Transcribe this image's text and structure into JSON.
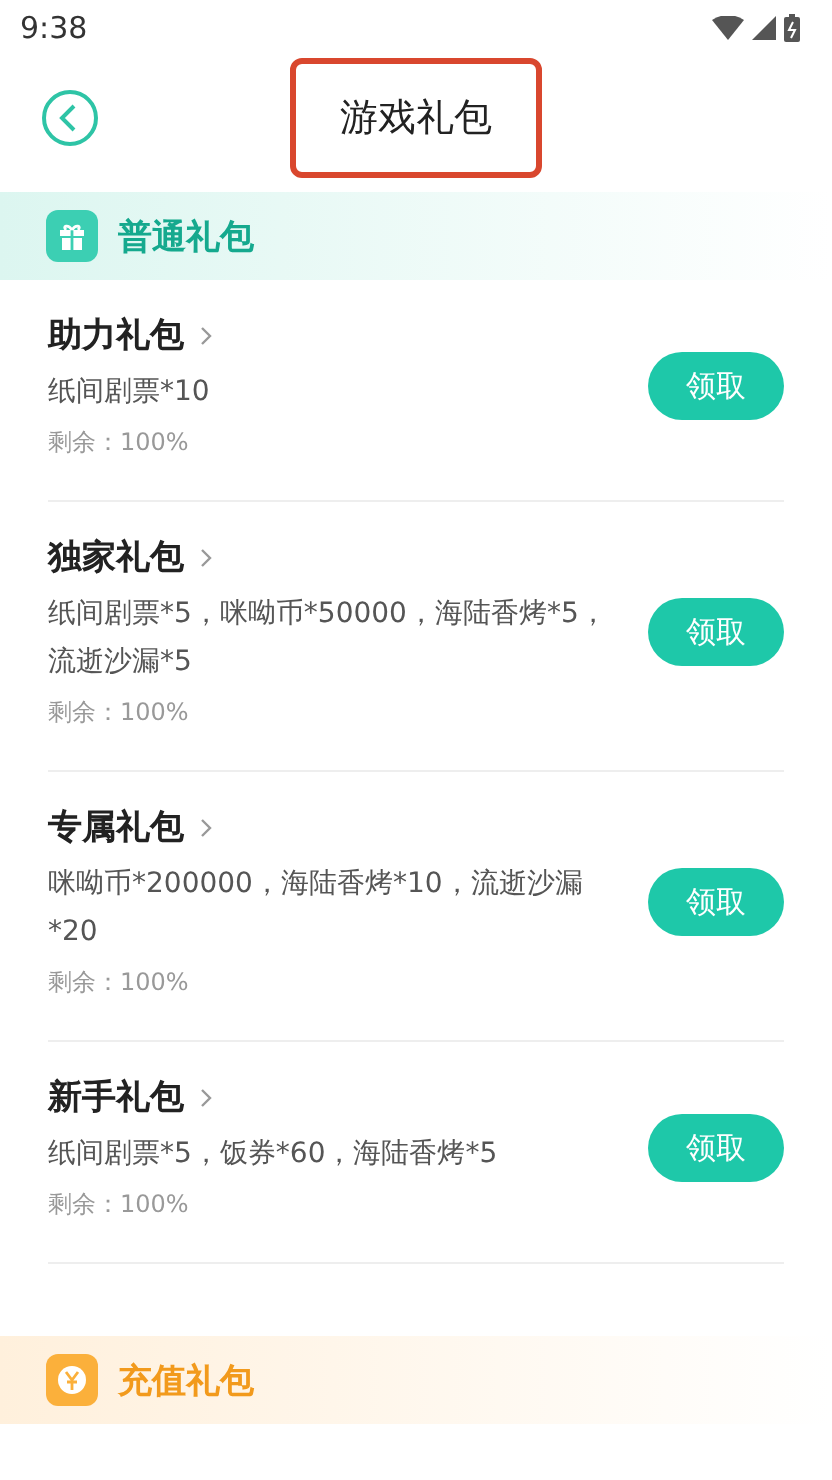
{
  "status_bar": {
    "time": "9:38"
  },
  "header": {
    "title": "游戏礼包",
    "title_highlighted": true
  },
  "sections": [
    {
      "kind": "gift",
      "title": "普通礼包",
      "items": [
        {
          "name": "助力礼包",
          "rewards": "纸间剧票*10",
          "remaining": "剩余：100%",
          "button": "领取"
        },
        {
          "name": "独家礼包",
          "rewards": "纸间剧票*5，咪呦币*50000，海陆香烤*5，流逝沙漏*5",
          "remaining": "剩余：100%",
          "button": "领取"
        },
        {
          "name": "专属礼包",
          "rewards": "咪呦币*200000，海陆香烤*10，流逝沙漏*20",
          "remaining": "剩余：100%",
          "button": "领取"
        },
        {
          "name": "新手礼包",
          "rewards": "纸间剧票*5，饭券*60，海陆香烤*5",
          "remaining": "剩余：100%",
          "button": "领取"
        }
      ]
    },
    {
      "kind": "recharge",
      "title": "充值礼包"
    }
  ]
}
